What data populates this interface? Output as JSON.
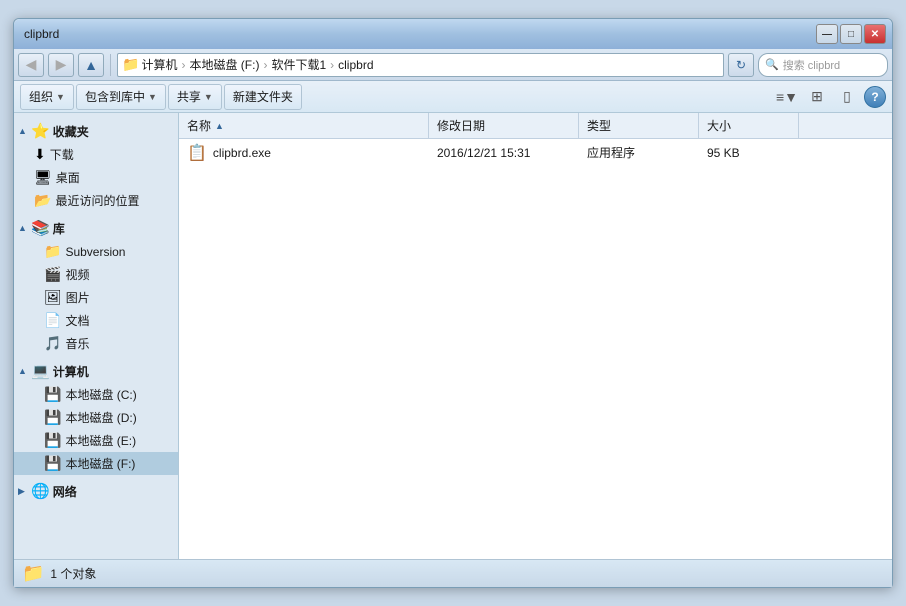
{
  "window": {
    "title": "clipbrd",
    "controls": {
      "minimize": "—",
      "maximize": "□",
      "close": "✕"
    }
  },
  "navbar": {
    "back_tooltip": "后退",
    "forward_tooltip": "前进",
    "address_parts": [
      "计算机",
      "本地磁盘 (F:)",
      "软件下载1",
      "clipbrd"
    ],
    "refresh_label": "↻",
    "search_placeholder": "搜索 clipbrd",
    "search_icon": "🔍"
  },
  "toolbar": {
    "organize_label": "组织",
    "include_label": "包含到库中",
    "share_label": "共享",
    "new_folder_label": "新建文件夹",
    "view_icon": "≡",
    "layout_icon": "⊞",
    "help_label": "?"
  },
  "sidebar": {
    "favorites": {
      "label": "收藏夹",
      "items": [
        {
          "label": "下载",
          "icon": "⬇"
        },
        {
          "label": "桌面",
          "icon": "🖥"
        },
        {
          "label": "最近访问的位置",
          "icon": "📂"
        }
      ]
    },
    "library": {
      "label": "库",
      "items": [
        {
          "label": "Subversion",
          "icon": "📁"
        },
        {
          "label": "视频",
          "icon": "🎬"
        },
        {
          "label": "图片",
          "icon": "🖼"
        },
        {
          "label": "文档",
          "icon": "📄"
        },
        {
          "label": "音乐",
          "icon": "🎵"
        }
      ]
    },
    "computer": {
      "label": "计算机",
      "items": [
        {
          "label": "本地磁盘 (C:)",
          "icon": "💾"
        },
        {
          "label": "本地磁盘 (D:)",
          "icon": "💾"
        },
        {
          "label": "本地磁盘 (E:)",
          "icon": "💾"
        },
        {
          "label": "本地磁盘 (F:)",
          "icon": "💾",
          "selected": true
        }
      ]
    },
    "network": {
      "label": "网络",
      "icon": "🌐"
    }
  },
  "file_list": {
    "columns": [
      {
        "label": "名称",
        "key": "name",
        "sorted": true,
        "sort_dir": "asc"
      },
      {
        "label": "修改日期",
        "key": "date"
      },
      {
        "label": "类型",
        "key": "type"
      },
      {
        "label": "大小",
        "key": "size"
      }
    ],
    "files": [
      {
        "name": "clipbrd.exe",
        "date": "2016/12/21 15:31",
        "type": "应用程序",
        "size": "95 KB",
        "icon": "📋"
      }
    ]
  },
  "statusbar": {
    "icon": "📁",
    "text": "1 个对象"
  }
}
